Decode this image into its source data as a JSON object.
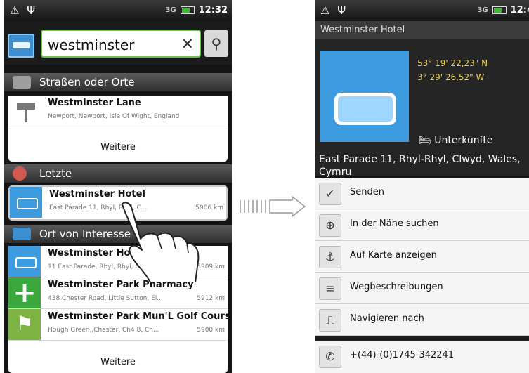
{
  "status": {
    "time_left": "12:32",
    "time_right": "12:4",
    "left_icons": "⚠ Ψ",
    "signal": "3G",
    "batt_label": ""
  },
  "search": {
    "query": "westminster",
    "clear": "✕",
    "search_icon": "⚲"
  },
  "sections": {
    "streets": "Straßen oder Orte",
    "recent": "Letzte",
    "poi": "Ort von Interesse"
  },
  "streets": {
    "item_title": "Westminster Lane",
    "item_sub": "Newport, Newport, Isle Of Wight, England",
    "more": "Weitere"
  },
  "recent": {
    "title": "Westminster Hotel",
    "sub": "East Parade 11, Rhyl, Rhyl, C...",
    "dist": "5906 km"
  },
  "poi_items": [
    {
      "title": "Westminster Hotel",
      "sub": "11 East Parade, Rhyl, Rhyl, C...",
      "dist": "5909 km",
      "icon": "hotel-icon"
    },
    {
      "title": "Westminster Park Pharmacy",
      "sub": "438 Chester Road, Little Sutton, El...",
      "dist": "5912 km",
      "icon": "pharmacy-icon"
    },
    {
      "title": "Westminster Park Mun'L Golf Course",
      "sub": "Hough Green,,Chester, Ch4 8, Ch...",
      "dist": "5900 km",
      "icon": "golf-icon"
    }
  ],
  "poi_more": "Weitere",
  "detail": {
    "header": "Westminster Hotel",
    "lat": "53° 19' 22,23\" N",
    "lon": "3° 29' 26,52\" W",
    "category": "Unterkünfte",
    "category_icon": "🛏",
    "address": "East Parade 11, Rhyl-Rhyl, Clwyd, Wales, Cymru"
  },
  "actions": [
    {
      "label": "Senden",
      "icon": "✓",
      "icon_name": "send-icon"
    },
    {
      "label": "In der Nähe suchen",
      "icon": "⊕",
      "icon_name": "search-nearby-icon"
    },
    {
      "label": "Auf Karte anzeigen",
      "icon": "⚓",
      "icon_name": "map-pin-icon"
    },
    {
      "label": "Wegbeschreibungen",
      "icon": "≡",
      "icon_name": "directions-icon"
    },
    {
      "label": "Navigieren nach",
      "icon": "⎍",
      "icon_name": "navigate-icon"
    }
  ],
  "phone_number": "+(44)-(0)1745-342241",
  "phone_icon": "✆"
}
